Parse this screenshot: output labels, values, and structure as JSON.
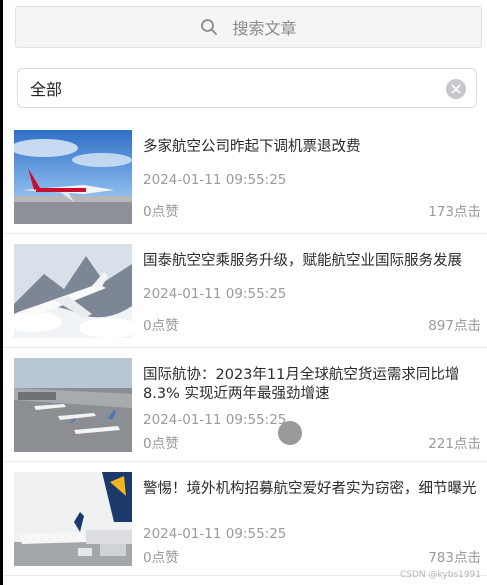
{
  "search": {
    "placeholder": "搜索文章"
  },
  "filter": {
    "value": "全部"
  },
  "articles": [
    {
      "title": "多家航空公司昨起下调机票退改费",
      "date": "2024-01-11 09:55:25",
      "likes": "0点赞",
      "clicks": "173点击",
      "image": "plane-red-tail-runway"
    },
    {
      "title": "国泰航空空乘服务升级，赋能航空业国际服务发展",
      "date": "2024-01-11 09:55:25",
      "likes": "0点赞",
      "clicks": "897点击",
      "image": "plane-above-clouds-mountains"
    },
    {
      "title": "国际航协：2023年11月全球航空货运需求同比增8.3% 实现近两年最强劲增速",
      "date": "2024-01-11 09:55:25",
      "likes": "0点赞",
      "clicks": "221点击",
      "image": "airport-apron-aerial"
    },
    {
      "title": "警惕！境外机构招募航空爱好者实为窃密，细节曝光",
      "date": "2024-01-11 09:55:25",
      "likes": "0点赞",
      "clicks": "783点击",
      "image": "planes-parked-at-gate"
    }
  ],
  "watermark": "CSDN @kybs1991",
  "colors": {
    "accent_text": "#2b2b2b",
    "meta_text": "#9a9a9a",
    "clear_button": "#c8c8cc"
  }
}
